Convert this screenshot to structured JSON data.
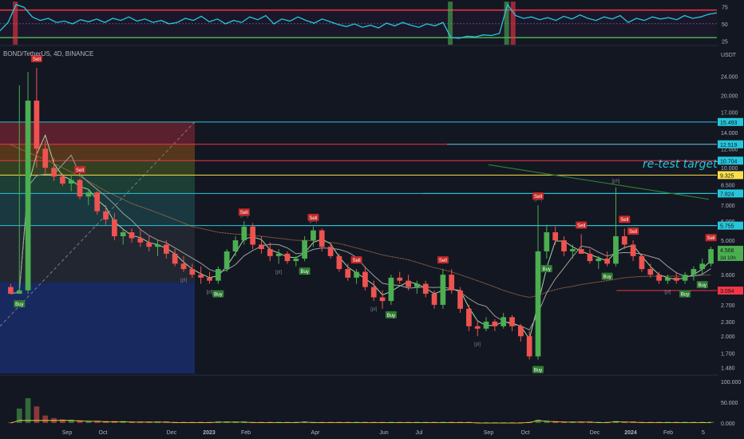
{
  "header": {
    "symbol_text": "BONDUSDT",
    "symbol_display": "BOND/TetherUS, 4D, BINANCE",
    "currency": "USDT"
  },
  "annotations": {
    "retest_text": "re-test target"
  },
  "colors": {
    "background": "#131722",
    "grid": "#1e222d",
    "up": "#26a69a",
    "candle_up": "#4caf50",
    "candle_down": "#ef5350",
    "cyan": "#26c6da",
    "yellow": "#ffeb3b",
    "red_level": "#f23645",
    "ema_orange": "#d4884a",
    "fib_blue": "#1a2d6b"
  },
  "chart_data": [
    {
      "type": "line",
      "name": "oscillator",
      "ylim": [
        22,
        80
      ],
      "yticks": [
        "75",
        "50",
        "25"
      ],
      "ytick_values": [
        75,
        50,
        25
      ],
      "levels": [
        70,
        30
      ],
      "x": [
        0,
        1,
        2,
        3,
        4,
        5,
        6,
        7,
        8,
        9,
        10,
        11,
        12,
        13,
        14,
        15,
        16,
        17,
        18,
        19,
        20,
        21,
        22,
        23,
        24,
        25,
        26,
        27,
        28,
        29,
        30,
        31,
        32,
        33,
        34,
        35,
        36,
        37,
        38,
        39,
        40,
        41,
        42,
        43,
        44,
        45,
        46,
        47,
        48,
        49,
        50,
        51,
        52,
        53,
        54,
        55,
        56,
        57,
        58,
        59,
        60,
        61,
        62,
        63,
        64,
        65,
        66,
        67,
        68,
        69,
        70,
        71,
        72,
        73,
        74,
        75,
        76,
        77,
        78,
        79,
        80,
        81,
        82,
        83,
        84,
        85,
        86,
        87,
        88,
        89
      ],
      "values": [
        40,
        52,
        78,
        74,
        60,
        55,
        58,
        52,
        54,
        50,
        56,
        53,
        57,
        52,
        58,
        55,
        60,
        54,
        57,
        52,
        55,
        50,
        52,
        58,
        55,
        61,
        53,
        57,
        50,
        55,
        52,
        60,
        56,
        62,
        50,
        57,
        54,
        60,
        55,
        51,
        57,
        53,
        49,
        46,
        50,
        45,
        48,
        44,
        51,
        47,
        52,
        48,
        45,
        50,
        47,
        52,
        30,
        29,
        32,
        31,
        34,
        33,
        36,
        78,
        62,
        58,
        60,
        56,
        59,
        55,
        61,
        57,
        63,
        58,
        55,
        60,
        57,
        62,
        52,
        58,
        55,
        60,
        57,
        59,
        56,
        62,
        58,
        60,
        64,
        66
      ]
    },
    {
      "type": "candlestick",
      "name": "price",
      "ylim": [
        1.4,
        27
      ],
      "log_scale": true,
      "xticks": [
        "Sep",
        "Oct",
        "Dec",
        "2023",
        "Feb",
        "Apr",
        "Jun",
        "Jul",
        "Sep",
        "Oct",
        "Dec",
        "2024",
        "Feb",
        "5"
      ],
      "yticks": [
        "24.000",
        "20.000",
        "17.000",
        "14.000",
        "12.000",
        "10.000",
        "8.500",
        "7.000",
        "6.000",
        "5.000",
        "4.300",
        "3.600",
        "3.100",
        "2.700",
        "2.300",
        "2.000",
        "1.700",
        "1.480"
      ],
      "ytick_values": [
        24,
        20,
        17,
        14,
        12,
        10,
        8.5,
        7,
        6,
        5,
        4.3,
        3.6,
        3.1,
        2.7,
        2.3,
        2,
        1.7,
        1.48
      ],
      "price_labels": [
        "15.493",
        "12.519",
        "10.704",
        "9.325",
        "7.824",
        "5.755",
        "4.568",
        "3.094"
      ],
      "price_label_values": [
        15.493,
        12.519,
        10.704,
        9.325,
        7.824,
        5.755,
        4.568,
        3.094
      ],
      "price_label_colors": [
        "#26c6da",
        "#26c6da",
        "#26c6da",
        "#f9e04b",
        "#26c6da",
        "#26c6da",
        "#4caf50",
        "#f23645"
      ],
      "last_price_sub": "3d 10h",
      "horizontal_levels": [
        {
          "y": 15.493,
          "color": "#26c6da",
          "from": 0
        },
        {
          "y": 12.519,
          "color": "#f23645",
          "from": 0
        },
        {
          "y": 10.704,
          "color": "#f23645",
          "from": 0
        },
        {
          "y": 9.325,
          "color": "#f9e04b",
          "from": 0
        },
        {
          "y": 7.824,
          "color": "#26c6da",
          "from": 0
        },
        {
          "y": 5.755,
          "color": "#26c6da",
          "from": 0
        },
        {
          "y": 3.094,
          "color": "#f23645",
          "from": 0.86
        }
      ],
      "fib_zones": [
        {
          "top": 15.493,
          "bottom": 12.519,
          "color": "#f23645",
          "opacity": 0.32
        },
        {
          "top": 12.519,
          "bottom": 10.704,
          "color": "#c56a12",
          "opacity": 0.38
        },
        {
          "top": 10.704,
          "bottom": 9.325,
          "color": "#6b8e23",
          "opacity": 0.36
        },
        {
          "top": 9.325,
          "bottom": 7.824,
          "color": "#2e8b57",
          "opacity": 0.34
        },
        {
          "top": 7.824,
          "bottom": 5.755,
          "color": "#2a7f7f",
          "opacity": 0.32
        },
        {
          "top": 5.755,
          "bottom": 3.35,
          "color": "#5b5f6b",
          "opacity": 0.22
        },
        {
          "top": 3.35,
          "bottom": 1.4,
          "color": "#1a2d6b",
          "opacity": 0.85
        }
      ],
      "ohlc": [
        [
          3.2,
          3.3,
          3.1,
          3.0
        ],
        [
          3.0,
          22,
          3.0,
          3.1
        ],
        [
          3.1,
          25,
          3.0,
          19
        ],
        [
          19,
          26,
          10,
          12
        ],
        [
          12,
          13,
          9.5,
          10
        ],
        [
          10,
          11,
          8.8,
          9.2
        ],
        [
          9.2,
          9.5,
          8.4,
          8.6
        ],
        [
          8.6,
          9.4,
          8.0,
          8.9
        ],
        [
          8.9,
          9.0,
          7.4,
          7.6
        ],
        [
          7.6,
          8.2,
          7.0,
          7.9
        ],
        [
          7.9,
          8.0,
          6.4,
          6.6
        ],
        [
          6.6,
          7.0,
          5.8,
          6.1
        ],
        [
          6.1,
          6.5,
          5.0,
          5.2
        ],
        [
          5.2,
          5.6,
          4.8,
          5.4
        ],
        [
          5.4,
          5.6,
          4.9,
          5.1
        ],
        [
          5.1,
          5.5,
          4.7,
          4.9
        ],
        [
          4.9,
          5.2,
          4.5,
          4.7
        ],
        [
          4.7,
          5.0,
          4.3,
          4.8
        ],
        [
          4.8,
          5.0,
          4.2,
          4.4
        ],
        [
          4.4,
          4.6,
          3.9,
          4.0
        ],
        [
          4.0,
          4.3,
          3.7,
          3.8
        ],
        [
          3.8,
          4.0,
          3.5,
          3.6
        ],
        [
          3.6,
          3.9,
          3.3,
          3.5
        ],
        [
          3.5,
          3.7,
          3.3,
          3.4
        ],
        [
          3.4,
          3.9,
          3.3,
          3.8
        ],
        [
          3.8,
          4.6,
          3.7,
          4.5
        ],
        [
          4.5,
          5.2,
          4.3,
          5.0
        ],
        [
          5.0,
          6.0,
          4.8,
          5.7
        ],
        [
          5.7,
          5.9,
          4.6,
          4.8
        ],
        [
          4.8,
          5.2,
          4.4,
          4.6
        ],
        [
          4.6,
          4.9,
          4.1,
          4.3
        ],
        [
          4.3,
          4.6,
          4.0,
          4.4
        ],
        [
          4.4,
          4.5,
          4.0,
          4.1
        ],
        [
          4.1,
          4.3,
          3.9,
          4.2
        ],
        [
          4.2,
          5.2,
          4.1,
          5.0
        ],
        [
          5.0,
          5.7,
          4.7,
          5.5
        ],
        [
          5.5,
          5.6,
          4.5,
          4.7
        ],
        [
          4.7,
          4.9,
          4.2,
          4.3
        ],
        [
          4.3,
          4.4,
          3.7,
          3.8
        ],
        [
          3.8,
          4.0,
          3.4,
          3.5
        ],
        [
          3.5,
          3.8,
          3.3,
          3.7
        ],
        [
          3.7,
          3.9,
          3.1,
          3.2
        ],
        [
          3.2,
          3.4,
          2.8,
          2.9
        ],
        [
          2.9,
          3.1,
          2.6,
          2.8
        ],
        [
          2.8,
          3.6,
          2.7,
          3.5
        ],
        [
          3.5,
          3.7,
          3.3,
          3.4
        ],
        [
          3.4,
          3.6,
          3.1,
          3.2
        ],
        [
          3.2,
          3.4,
          3.0,
          3.3
        ],
        [
          3.3,
          3.4,
          2.9,
          3.0
        ],
        [
          3.0,
          3.1,
          2.6,
          2.7
        ],
        [
          2.7,
          3.8,
          2.6,
          3.6
        ],
        [
          3.6,
          3.8,
          3.0,
          3.1
        ],
        [
          3.1,
          3.2,
          2.5,
          2.6
        ],
        [
          2.6,
          2.7,
          2.1,
          2.2
        ],
        [
          2.2,
          2.3,
          2.0,
          2.15
        ],
        [
          2.15,
          2.4,
          2.1,
          2.3
        ],
        [
          2.3,
          2.35,
          2.1,
          2.2
        ],
        [
          2.2,
          2.5,
          2.15,
          2.4
        ],
        [
          2.4,
          2.45,
          2.1,
          2.2
        ],
        [
          2.2,
          2.25,
          1.9,
          2.0
        ],
        [
          2.0,
          2.1,
          1.6,
          1.65
        ],
        [
          1.65,
          7.0,
          1.6,
          4.5
        ],
        [
          4.5,
          5.8,
          4.2,
          5.4
        ],
        [
          5.4,
          5.7,
          4.8,
          5.0
        ],
        [
          5.0,
          5.2,
          4.3,
          4.5
        ],
        [
          4.5,
          4.8,
          4.2,
          4.6
        ],
        [
          4.6,
          5.3,
          4.4,
          4.4
        ],
        [
          4.4,
          4.6,
          4.0,
          4.1
        ],
        [
          4.1,
          4.3,
          3.8,
          4.2
        ],
        [
          4.2,
          4.5,
          3.9,
          4.0
        ],
        [
          4.0,
          8.3,
          3.9,
          5.2
        ],
        [
          5.2,
          5.6,
          4.6,
          4.8
        ],
        [
          4.8,
          5.0,
          4.1,
          4.3
        ],
        [
          4.3,
          4.4,
          3.7,
          3.8
        ],
        [
          3.8,
          4.0,
          3.5,
          3.6
        ],
        [
          3.6,
          3.7,
          3.3,
          3.4
        ],
        [
          3.4,
          3.6,
          3.3,
          3.5
        ],
        [
          3.5,
          3.7,
          3.3,
          3.4
        ],
        [
          3.4,
          3.7,
          3.3,
          3.6
        ],
        [
          3.6,
          3.9,
          3.4,
          3.8
        ],
        [
          3.8,
          4.2,
          3.6,
          4.0
        ],
        [
          4.0,
          4.7,
          3.9,
          4.6
        ]
      ],
      "ema": [
        12.5,
        12.0,
        11.6,
        11.2,
        10.8,
        10.4,
        10.0,
        9.6,
        9.2,
        8.8,
        8.4,
        8.0,
        7.7,
        7.4,
        7.1,
        6.9,
        6.7,
        6.5,
        6.3,
        6.1,
        5.9,
        5.7,
        5.6,
        5.5,
        5.4,
        5.35,
        5.3,
        5.3,
        5.25,
        5.2,
        5.15,
        5.1,
        5.05,
        5.0,
        5.0,
        4.98,
        4.95,
        4.9,
        4.85,
        4.75,
        4.65,
        4.55,
        4.45,
        4.35,
        4.28,
        4.22,
        4.15,
        4.05,
        3.95,
        3.85,
        3.78,
        3.7,
        3.6,
        3.5,
        3.4,
        3.3,
        3.2,
        3.1,
        3.02,
        2.95,
        2.9,
        2.95,
        3.05,
        3.12,
        3.18,
        3.22,
        3.28,
        3.32,
        3.36,
        3.4,
        3.45,
        3.5,
        3.52,
        3.54,
        3.55,
        3.55,
        3.55,
        3.55,
        3.55,
        3.56,
        3.58,
        3.6
      ],
      "signals": [
        {
          "i": 1,
          "text": "Buy",
          "kind": "buy"
        },
        {
          "i": 3,
          "text": "Sell",
          "kind": "sell"
        },
        {
          "i": 8,
          "text": "Sell",
          "kind": "sell"
        },
        {
          "i": 24,
          "text": "Buy",
          "kind": "buy"
        },
        {
          "i": 27,
          "text": "Sell",
          "kind": "sell"
        },
        {
          "i": 35,
          "text": "Sell",
          "kind": "sell"
        },
        {
          "i": 34,
          "text": "Buy",
          "kind": "buy"
        },
        {
          "i": 40,
          "text": "Sell",
          "kind": "sell"
        },
        {
          "i": 44,
          "text": "Buy",
          "kind": "buy"
        },
        {
          "i": 50,
          "text": "Sell",
          "kind": "sell"
        },
        {
          "i": 61,
          "text": "Sell",
          "kind": "sell"
        },
        {
          "i": 61,
          "text": "Buy",
          "kind": "buy"
        },
        {
          "i": 62,
          "text": "Buy",
          "kind": "buy"
        },
        {
          "i": 66,
          "text": "Sell",
          "kind": "sell"
        },
        {
          "i": 69,
          "text": "Buy",
          "kind": "buy"
        },
        {
          "i": 71,
          "text": "Sell",
          "kind": "sell"
        },
        {
          "i": 72,
          "text": "Sell",
          "kind": "sell"
        },
        {
          "i": 78,
          "text": "Buy",
          "kind": "buy"
        },
        {
          "i": 80,
          "text": "Buy",
          "kind": "buy"
        },
        {
          "i": 81,
          "text": "Sell",
          "kind": "sell"
        }
      ],
      "pivot_labels": [
        {
          "i": 27,
          "text": "[ph]"
        },
        {
          "i": 35,
          "text": "[ph]"
        },
        {
          "i": 61,
          "text": "[ph]"
        },
        {
          "i": 70,
          "text": "[ph]"
        },
        {
          "i": 20,
          "text": "[pl]"
        },
        {
          "i": 23,
          "text": "[pl]"
        },
        {
          "i": 31,
          "text": "[pl]"
        },
        {
          "i": 42,
          "text": "[pl]"
        },
        {
          "i": 54,
          "text": "[pl]"
        },
        {
          "i": 76,
          "text": "[pl]"
        }
      ]
    },
    {
      "type": "bar",
      "name": "volume",
      "ylim": [
        0,
        100
      ],
      "yticks": [
        "100.000",
        "50.000",
        "0.000"
      ],
      "ytick_values": [
        100,
        50,
        0
      ],
      "values": [
        2,
        35,
        60,
        40,
        18,
        12,
        9,
        8,
        7,
        6,
        6,
        5,
        5,
        5,
        4,
        4,
        4,
        4,
        4,
        3,
        3,
        3,
        3,
        3,
        4,
        4,
        4,
        4,
        3,
        3,
        3,
        3,
        3,
        3,
        4,
        3,
        3,
        3,
        3,
        3,
        3,
        3,
        3,
        3,
        3,
        3,
        3,
        3,
        3,
        3,
        3,
        3,
        3,
        3,
        2,
        2,
        2,
        2,
        2,
        2,
        3,
        8,
        6,
        5,
        4,
        4,
        4,
        4,
        3,
        3,
        5,
        4,
        4,
        3,
        3,
        3,
        3,
        3,
        3,
        3,
        3,
        3
      ]
    }
  ]
}
